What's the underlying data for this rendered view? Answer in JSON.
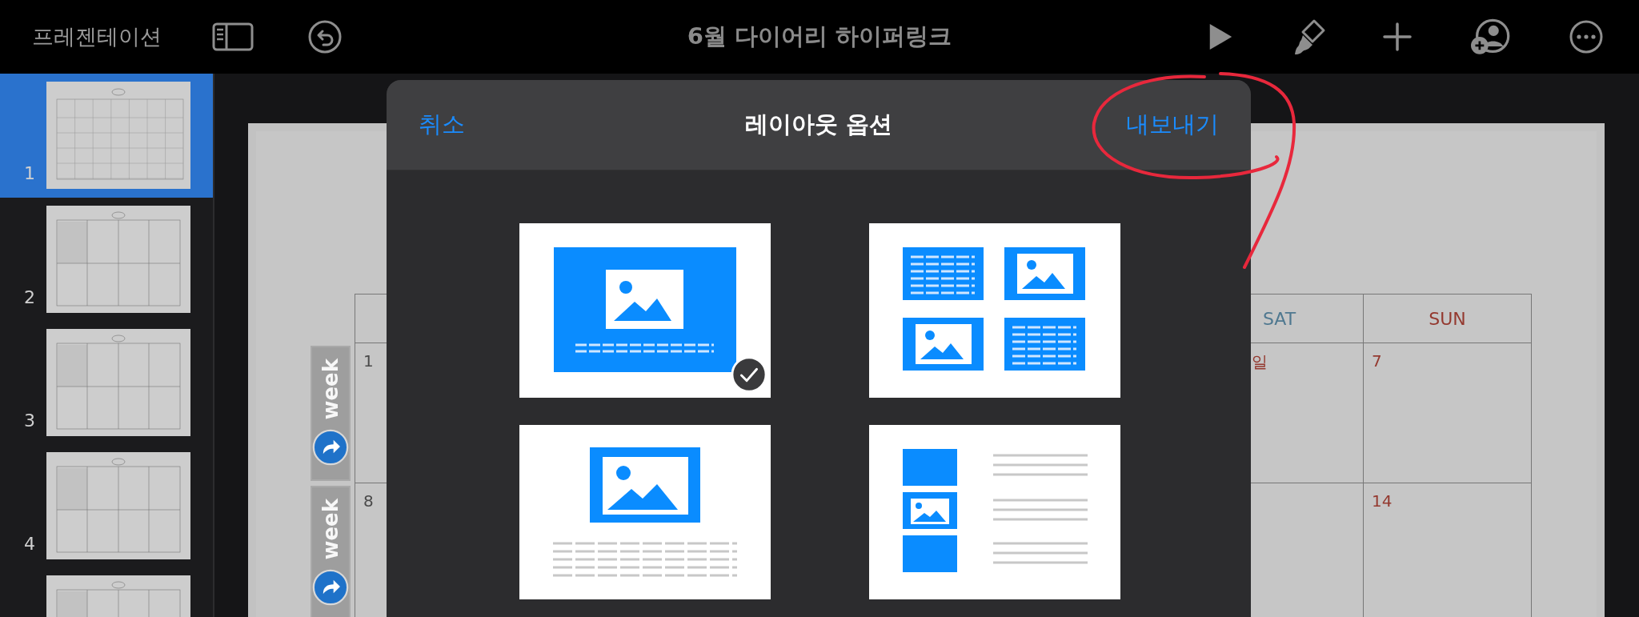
{
  "toolbar": {
    "back_label": "프레젠테이션",
    "title": "6월 다이어리 하이퍼링크"
  },
  "slides": [
    {
      "number": "1",
      "kind": "monthly",
      "selected": true
    },
    {
      "number": "2",
      "kind": "weekly",
      "selected": false
    },
    {
      "number": "3",
      "kind": "weekly",
      "selected": false
    },
    {
      "number": "4",
      "kind": "weekly",
      "selected": false
    },
    {
      "kind": "weekly",
      "selected": false
    }
  ],
  "calendar": {
    "columns": [
      {
        "label": "SAT",
        "color": "#4f7890"
      },
      {
        "label": "SUN",
        "color": "#94392f"
      }
    ],
    "rows": [
      {
        "date": "1",
        "week_tab": "week",
        "sat": "일",
        "sun": "7"
      },
      {
        "date": "8",
        "week_tab": "week",
        "sun": "14"
      }
    ]
  },
  "dialog": {
    "cancel": "취소",
    "title": "레이아웃 옵션",
    "export": "내보내기",
    "options": [
      {
        "kind": "full",
        "selected": true
      },
      {
        "kind": "grid",
        "selected": false
      },
      {
        "kind": "stacked",
        "selected": false
      },
      {
        "kind": "list",
        "selected": false
      }
    ]
  }
}
